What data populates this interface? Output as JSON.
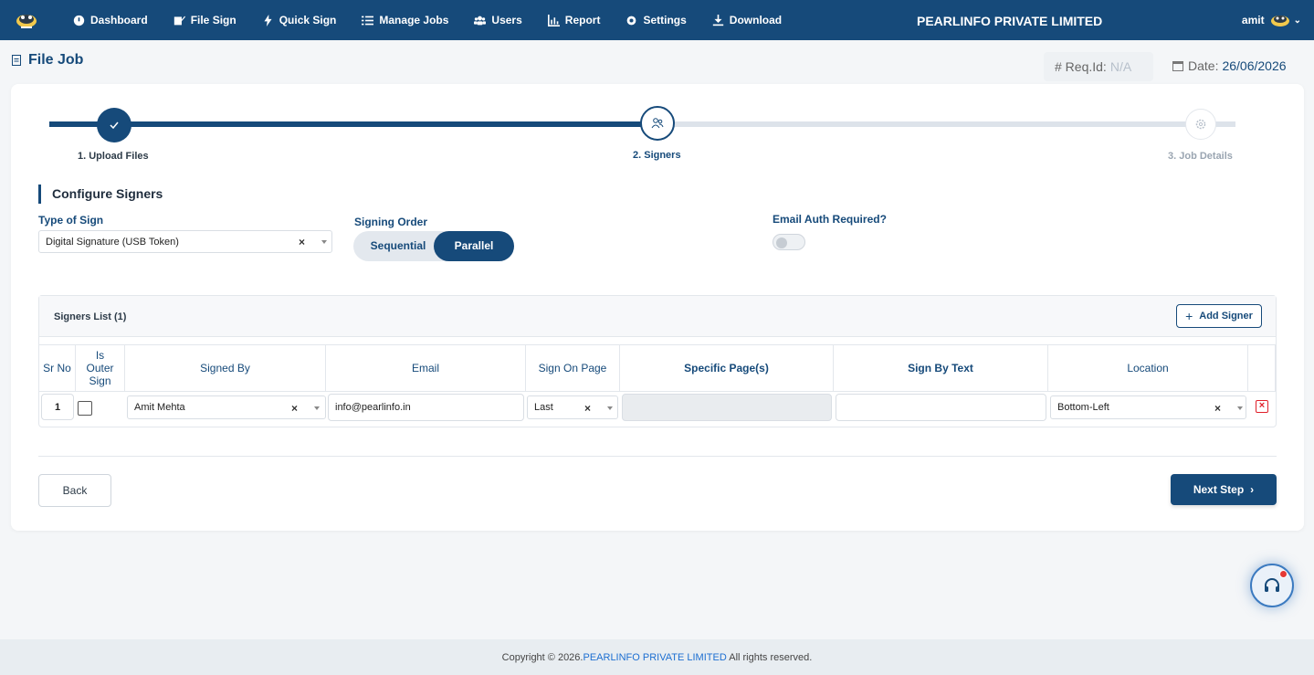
{
  "nav": {
    "items": [
      {
        "label": "Dashboard",
        "icon": "dashboard-icon"
      },
      {
        "label": "File Sign",
        "icon": "file-sign-icon"
      },
      {
        "label": "Quick Sign",
        "icon": "bolt-icon"
      },
      {
        "label": "Manage Jobs",
        "icon": "list-icon"
      },
      {
        "label": "Users",
        "icon": "users-icon"
      },
      {
        "label": "Report",
        "icon": "report-icon"
      },
      {
        "label": "Settings",
        "icon": "gear-icon"
      },
      {
        "label": "Download",
        "icon": "download-icon"
      }
    ],
    "brand": "PEARLINFO PRIVATE LIMITED",
    "user": "amit"
  },
  "page": {
    "title": "File Job",
    "req_label": "# Req.Id:",
    "req_value": "N/A",
    "date_label": "Date:",
    "date_value": "26/06/2026"
  },
  "stepper": {
    "steps": [
      {
        "label": "1. Upload Files",
        "status": "done"
      },
      {
        "label": "2. Signers",
        "status": "active"
      },
      {
        "label": "3. Job Details",
        "status": "pending"
      }
    ]
  },
  "config": {
    "heading": "Configure Signers",
    "type_of_sign_label": "Type of Sign",
    "type_of_sign_value": "Digital Signature (USB Token)",
    "signing_order_label": "Signing Order",
    "signing_order_options": [
      "Sequential",
      "Parallel"
    ],
    "signing_order_selected": "Parallel",
    "email_auth_label": "Email Auth Required?",
    "email_auth_enabled": false
  },
  "signers": {
    "title": "Signers List (1)",
    "add_label": "Add Signer",
    "columns": [
      "Sr No",
      "Is Outer Sign",
      "Signed By",
      "Email",
      "Sign On Page",
      "Specific Page(s)",
      "Sign By Text",
      "Location"
    ],
    "rows": [
      {
        "sr": "1",
        "outer_sign": false,
        "signed_by": "Amit Mehta",
        "email": "info@pearlinfo.in",
        "sign_on_page": "Last",
        "specific_pages": "",
        "sign_by_text": "",
        "location": "Bottom-Left"
      }
    ]
  },
  "actions": {
    "back": "Back",
    "next": "Next Step"
  },
  "footer": {
    "prefix": "Copyright © 2026.",
    "company": "PEARLINFO PRIVATE LIMITED",
    "suffix": " All rights reserved."
  },
  "colors": {
    "primary": "#164a7a",
    "danger": "#e0202a",
    "link": "#1d6fd1"
  }
}
